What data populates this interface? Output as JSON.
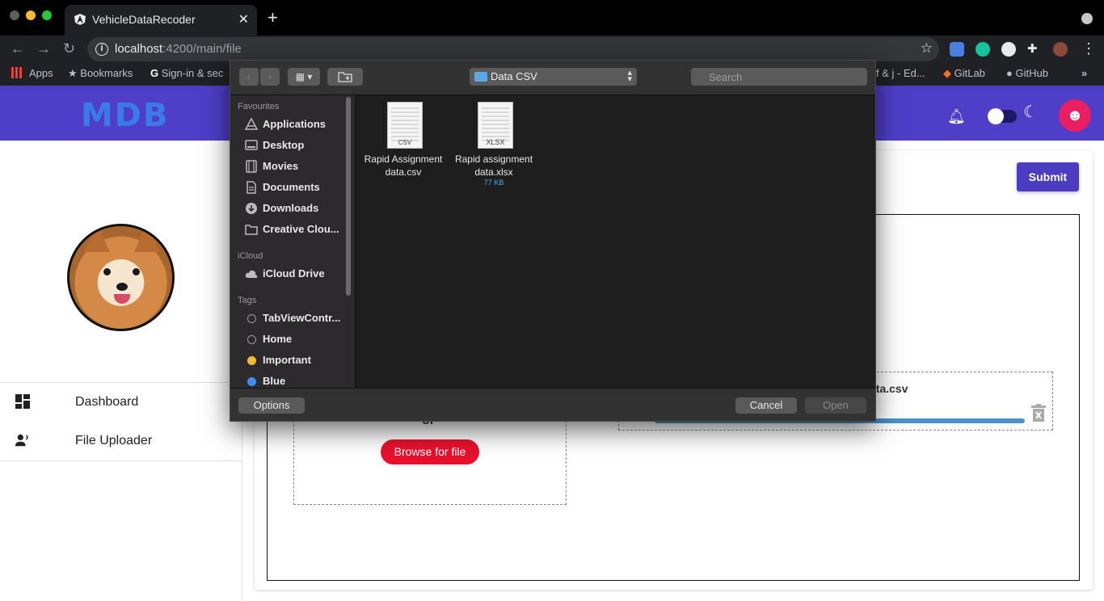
{
  "browser": {
    "tab_title": "VehicleDataRecoder",
    "url_host": "localhost",
    "url_path": ":4200/main/file",
    "bookmarks": {
      "apps": "Apps",
      "bookmarks": "Bookmarks",
      "signin": "Sign-in & sec",
      "edu": "f & j - Ed...",
      "gitlab": "GitLab",
      "github": "GitHub",
      "more": "»"
    }
  },
  "app": {
    "logo": "MDB",
    "submit_label": "Submit",
    "or_text": "or",
    "browse_label": "Browse for file",
    "uploaded_file": "ata.csv",
    "upload_progress_percent": 100,
    "nav": [
      {
        "label": "Dashboard"
      },
      {
        "label": "File Uploader"
      }
    ]
  },
  "dialog": {
    "current_folder": "Data CSV",
    "search_placeholder": "Search",
    "sections": {
      "favourites": "Favourites",
      "icloud": "iCloud",
      "tags": "Tags"
    },
    "favourites": [
      {
        "label": "Applications",
        "icon": "applications-icon"
      },
      {
        "label": "Desktop",
        "icon": "desktop-icon"
      },
      {
        "label": "Movies",
        "icon": "movies-icon"
      },
      {
        "label": "Documents",
        "icon": "documents-icon"
      },
      {
        "label": "Downloads",
        "icon": "downloads-icon"
      },
      {
        "label": "Creative Clou...",
        "icon": "folder-icon"
      }
    ],
    "icloud": [
      {
        "label": "iCloud Drive",
        "icon": "cloud-icon"
      }
    ],
    "tags": [
      {
        "label": "TabViewContr...",
        "color": "#2c2a2d"
      },
      {
        "label": "Home",
        "color": "#2c2a2d"
      },
      {
        "label": "Important",
        "color": "#f5b933"
      },
      {
        "label": "Blue",
        "color": "#3a8ef6"
      }
    ],
    "files": [
      {
        "name_line1": "Rapid Assignment",
        "name_line2": "data.csv",
        "ext": "CSV",
        "size": ""
      },
      {
        "name_line1": "Rapid assignment",
        "name_line2": "data.xlsx",
        "ext": "XLSX",
        "size": "77 KB"
      }
    ],
    "options_label": "Options",
    "cancel_label": "Cancel",
    "open_label": "Open"
  }
}
